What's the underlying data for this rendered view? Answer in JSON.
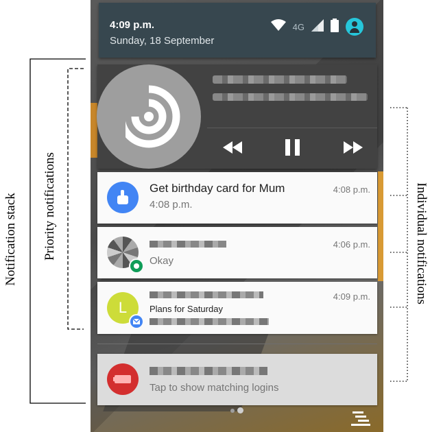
{
  "status_bar": {
    "time": "4:09 p.m.",
    "date": "Sunday, 18 September",
    "network": "4G",
    "accent_color": "#26c6da"
  },
  "media": {
    "title_redacted": true,
    "controls": [
      "rewind-icon",
      "pause-icon",
      "fast-forward-icon"
    ]
  },
  "notifications": [
    {
      "title": "Get birthday card for Mum",
      "text": "4:08 p.m.",
      "time": "4:08 p.m.",
      "icon": "reminder-hand-icon",
      "color": "#4285f4"
    },
    {
      "title": "",
      "text": "Okay",
      "time": "4:06 p.m.",
      "icon": "hangouts-badge-icon",
      "color": "#0f9d58"
    },
    {
      "title": "",
      "text": "Plans for Saturday",
      "time": "4:09 p.m.",
      "icon": "mail-badge-icon",
      "avatar_letter": "L",
      "color": "#cddc39"
    },
    {
      "title": "",
      "text": "Tap to show matching logins",
      "time": "",
      "icon": "lastpass-icon",
      "color": "#d32f2f"
    }
  ],
  "annotations": {
    "stack": "Notification stack",
    "priority": "Priority notifications",
    "individual": "Individual notifications"
  }
}
